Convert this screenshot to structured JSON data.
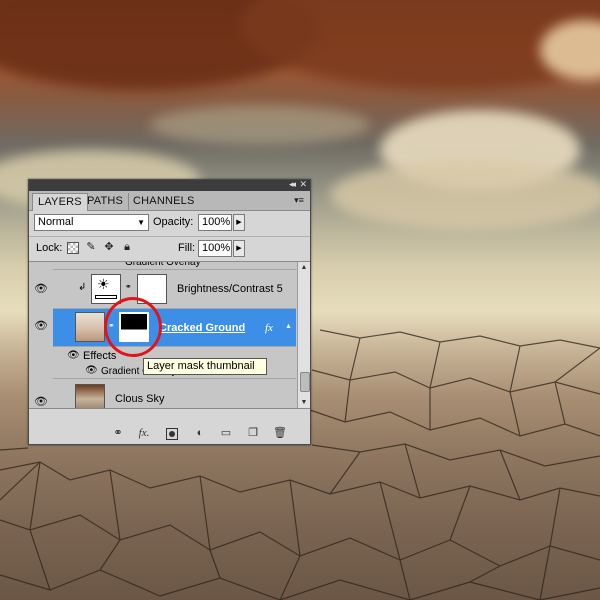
{
  "panel": {
    "tabs": [
      "LAYERS",
      "PATHS",
      "CHANNELS"
    ],
    "blend_mode": "Normal",
    "opacity_label": "Opacity:",
    "opacity_value": "100%",
    "lock_label": "Lock:",
    "fill_label": "Fill:",
    "fill_value": "100%"
  },
  "layers": {
    "partial_top_label": "Gradient Overlay",
    "brightness": "Brightness/Contrast 5",
    "cracked": "Cracked Ground",
    "fx_symbol": "fx",
    "effects_label": "Effects",
    "gradient_overlay": "Gradient Overlay",
    "sky": "Clous Sky"
  },
  "tooltip": "Layer mask thumbnail",
  "icons": {
    "link": "link-icon",
    "fx": "fx-icon",
    "mask": "add-mask-icon",
    "adjustment": "adjustment-layer-icon",
    "group": "folder-icon",
    "new": "new-layer-icon",
    "trash": "trash-icon"
  },
  "colors": {
    "selection": "#3d8ee6",
    "annotation": "#e0141c",
    "tooltip_bg": "#ffffe1"
  }
}
